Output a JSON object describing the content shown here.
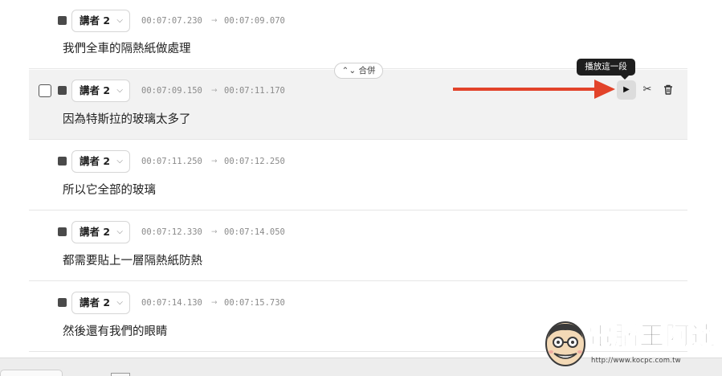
{
  "merge_label": "合併",
  "merge_icon": "chevron-up-down-icon",
  "tooltip": "播放這一段",
  "icons": {
    "play": "▶",
    "cut": "✂",
    "delete": "trash-icon",
    "chevron": "⌵"
  },
  "arrow_color": "#e2432a",
  "segments": [
    {
      "speaker": "講者 2",
      "start": "00:07:07.230",
      "arrow": "→",
      "end": "00:07:09.070",
      "text": "我們全車的隔熱紙做處理"
    },
    {
      "speaker": "講者 2",
      "start": "00:07:09.150",
      "arrow": "→",
      "end": "00:07:11.170",
      "text": "因為特斯拉的玻璃太多了"
    },
    {
      "speaker": "講者 2",
      "start": "00:07:11.250",
      "arrow": "→",
      "end": "00:07:12.250",
      "text": "所以它全部的玻璃"
    },
    {
      "speaker": "講者 2",
      "start": "00:07:12.330",
      "arrow": "→",
      "end": "00:07:14.050",
      "text": "都需要貼上一層隔熱紙防熱"
    },
    {
      "speaker": "講者 2",
      "start": "00:07:14.130",
      "arrow": "→",
      "end": "00:07:15.730",
      "text": "然後還有我們的眼睛"
    }
  ],
  "watermark": {
    "brand": "電腦王阿達",
    "url": "http://www.kocpc.com.tw"
  }
}
